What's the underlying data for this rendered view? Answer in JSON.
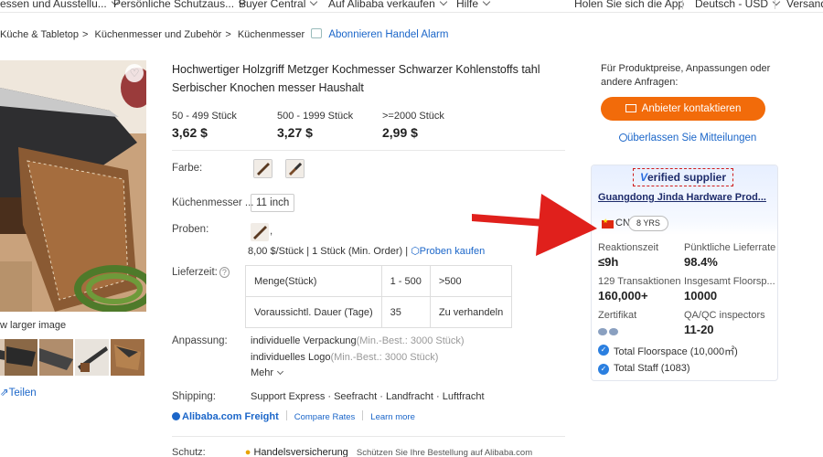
{
  "topnav": {
    "items": [
      "essen und Ausstellu...",
      "Persönliche Schutzaus...",
      "Buyer Central",
      "Auf Alibaba verkaufen",
      "Hilfe",
      "Holen Sie sich die App",
      "Deutsch - USD",
      "Versand"
    ]
  },
  "breadcrumb": {
    "items": [
      "Küche & Tabletop",
      "Küchenmesser und Zubehör",
      "Küchenmesser"
    ],
    "alarm": "Abonnieren Handel Alarm"
  },
  "gallery": {
    "view_larger": "w larger image",
    "share": "Teilen"
  },
  "product": {
    "title": "Hochwertiger Holzgriff Metzger Kochmesser Schwarzer Kohlenstoffs tahl Serbischer Knochen messer Haushalt",
    "tiers": [
      {
        "range": "50 - 499 Stück",
        "price": "3,62 $"
      },
      {
        "range": "500 - 1999 Stück",
        "price": "3,27 $"
      },
      {
        "range": ">=2000 Stück",
        "price": "2,99 $"
      }
    ],
    "color_label": "Farbe:",
    "size_label": "Küchenmesser ...",
    "size_value": "11 inch",
    "samples_label": "Proben:",
    "samples_comma": ",",
    "samples_price": "8,00 $/Stück | 1 Stück (Min. Order) |",
    "samples_link": "Proben kaufen",
    "lead_label": "Lieferzeit:",
    "lead_table": [
      [
        "Menge(Stück)",
        "1 - 500",
        ">500"
      ],
      [
        "Voraussichtl. Dauer (Tage)",
        "35",
        "Zu verhandeln"
      ]
    ],
    "custom_label": "Anpassung:",
    "custom": [
      {
        "name": "individuelle Verpackung",
        "min": "(Min.-Best.: 3000 Stück)"
      },
      {
        "name": "individuelles Logo",
        "min": "(Min.-Best.: 3000 Stück)"
      }
    ],
    "more": "Mehr",
    "shipping_label": "Shipping:",
    "shipping_methods": "Support Express · Seefracht · Landfracht · Luftfracht",
    "freight_brand": "Alibaba.com Freight",
    "freight_compare": "Compare Rates",
    "freight_learn": "Learn more",
    "protect_label": "Schutz:",
    "protect_name": "Handelsversicherung",
    "protect_desc": "Schützen Sie Ihre Bestellung auf Alibaba.com"
  },
  "sidebar": {
    "rfp": "Für Produktpreise, Anpassungen oder andere Anfragen:",
    "contact": "Anbieter kontaktieren",
    "leave_message": "überlassen Sie Mitteilungen",
    "verified_v": "V",
    "verified_rest": "erified supplier",
    "supplier_name": "Guangdong Jinda Hardware Prod...",
    "country": "CN",
    "years": "8 YRS",
    "stats": [
      {
        "label": "Reaktionszeit",
        "value": "≤9h"
      },
      {
        "label": "Pünktliche Lieferrate",
        "value": "98.4%"
      },
      {
        "label": "129 Transaktionen",
        "value": "160,000+"
      },
      {
        "label": "Insgesamt Floorsp...",
        "value": "10000"
      },
      {
        "label": "Zertifikat",
        "value": ""
      },
      {
        "label": "QA/QC inspectors",
        "value": "11-20"
      }
    ],
    "checks": [
      "Total Floorspace (10,000㎡)",
      "Total Staff (1083)"
    ]
  },
  "colors": {
    "accent": "#f26b0a",
    "link": "#1b66c9",
    "annotation_arrow": "#e0201c"
  }
}
